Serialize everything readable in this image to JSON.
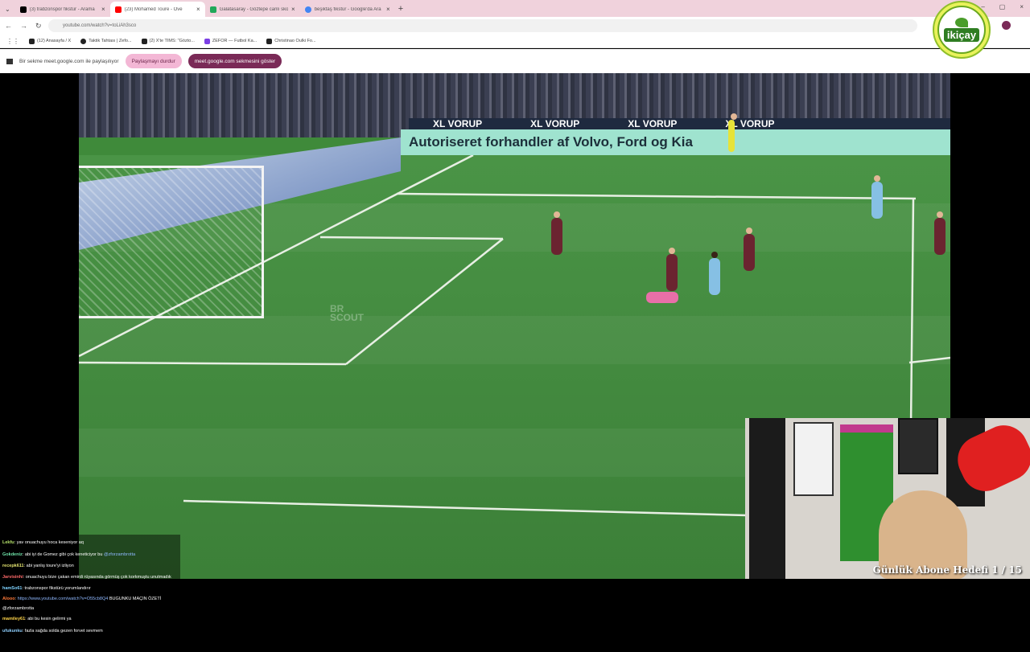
{
  "tabs": [
    {
      "title": "(3) trabzonspor fikstür - Arama",
      "favicon_color": "#000000"
    },
    {
      "title": "(23) Mohamed Toure - Ove",
      "favicon_color": "#ff0000",
      "active": true
    },
    {
      "title": "Galatasaray - Göztepe canlı sko",
      "favicon_color": "#22a85a"
    },
    {
      "title": "beşiktaş fikstür - Google'da Ara",
      "favicon_color": "#4285f4"
    }
  ],
  "url": "youtube.com/watch?v=toLiAh3sco",
  "bookmarks": [
    "(12) Anasayfa / X",
    "Taktik Tahtası | Zefo...",
    "(2) X'te TIMS: \"Gözto...",
    "ZEFOR — Futbol Ka...",
    "Christinao Oulki Fo..."
  ],
  "share_bar": {
    "text": "Bir sekme meet.google.com ile paylaşılıyor",
    "stop_label": "Paylaşmayı durdur",
    "show_label": "meet.google.com sekmesini göster"
  },
  "logo_text": "ikiçay",
  "video": {
    "ad_top": "XL VORUP",
    "ad_main": "Autoriseret forhandler af Volvo, Ford og Kia",
    "watermark": "BR SCOUT"
  },
  "chat": [
    {
      "user": "Lekfu",
      "msg": ": yav onuachuyu hoca keseniyor aq"
    },
    {
      "user": "Gokdeniz",
      "msg": ": abi iyi de Gomez gibi çok keneticiyor bu",
      "link": "@zforzambrotta"
    },
    {
      "user": "recepk611",
      "msg": ": abi yanlış toure'yi izliyon"
    },
    {
      "user": "Jarvisinhi",
      "msg": ": onuachuyu bize çakan emirdi rüyasında görmüş çok korkmuştu unutmadık"
    },
    {
      "user": "hamSo61",
      "msg": ": trabzonspor fikstürü yorumlandırır"
    },
    {
      "user": "Alooo",
      "msg": ": ",
      "link": "https://www.youtube.com/watch?v=O55cb8Q4",
      "tail": " BUGUNKU MAÇIN ÖZETİ @zforzambrotta"
    },
    {
      "user": "mamiley61",
      "msg": ": abi bu kesin gelirmi ya"
    },
    {
      "user": "ufukunku",
      "msg": ": fazla sağda solda gezen forvet sevmem"
    }
  ],
  "goal_text": "Günlük Abone Hedefi 1 / 15"
}
